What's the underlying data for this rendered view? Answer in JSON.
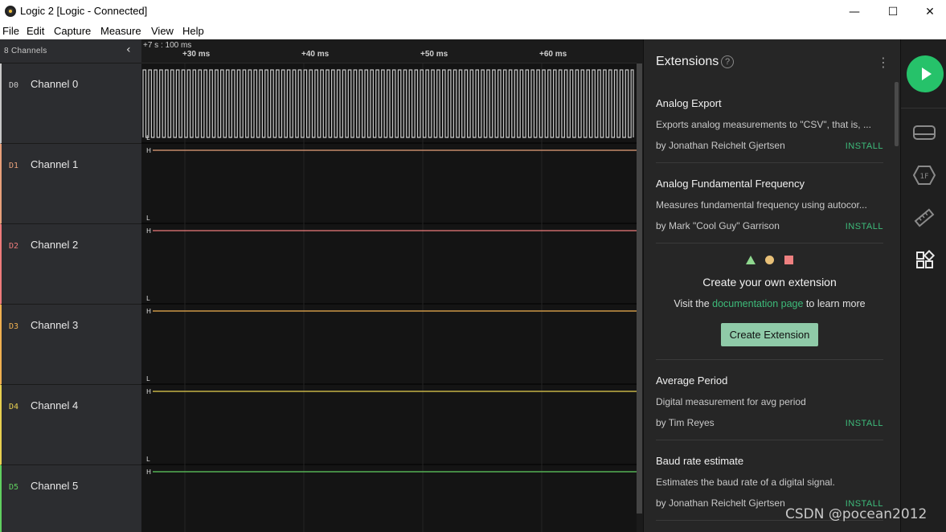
{
  "window": {
    "title": "Logic 2 [Logic - Connected]",
    "min_glyph": "—",
    "max_glyph": "☐",
    "close_glyph": "✕"
  },
  "menu": [
    "File",
    "Edit",
    "Capture",
    "Measure",
    "View",
    "Help"
  ],
  "channels_panel": {
    "header": "8 Channels",
    "collapse_glyph": "‹"
  },
  "channels": [
    {
      "id": "D0",
      "name": "Channel 0",
      "color": "#c8c8c8"
    },
    {
      "id": "D1",
      "name": "Channel 1",
      "color": "#e8a07a"
    },
    {
      "id": "D2",
      "name": "Channel 2",
      "color": "#ee7b7b"
    },
    {
      "id": "D3",
      "name": "Channel 3",
      "color": "#f0b050"
    },
    {
      "id": "D4",
      "name": "Channel 4",
      "color": "#e8d050"
    },
    {
      "id": "D5",
      "name": "Channel 5",
      "color": "#60d060"
    }
  ],
  "waveform": {
    "high_label": "H",
    "low_label": "L"
  },
  "ruler": {
    "offset": "+7 s : 100 ms",
    "ticks": [
      "+30 ms",
      "+40 ms",
      "+50 ms",
      "+60 ms"
    ]
  },
  "extensions": {
    "title": "Extensions",
    "help_glyph": "?",
    "more_glyph": "⋮",
    "items": [
      {
        "name": "Analog Export",
        "desc": "Exports analog measurements to \"CSV\", that is, ...",
        "author": "by Jonathan Reichelt Gjertsen",
        "action": "INSTALL"
      },
      {
        "name": "Analog Fundamental Frequency",
        "desc": "Measures fundamental frequency using autocor...",
        "author": "by Mark \"Cool Guy\" Garrison",
        "action": "INSTALL"
      },
      {
        "name": "Average Period",
        "desc": "Digital measurement for avg period",
        "author": "by Tim Reyes",
        "action": "INSTALL"
      },
      {
        "name": "Baud rate estimate",
        "desc": "Estimates the baud rate of a digital signal.",
        "author": "by Jonathan Reichelt Gjertsen",
        "action": "INSTALL"
      }
    ],
    "create": {
      "title": "Create your own extension",
      "line_before": "Visit the",
      "link": "documentation page",
      "line_after": "to learn more",
      "button": "Create Extension"
    }
  },
  "toolbar": {
    "play_color": "#26c26a",
    "icons": [
      "device-icon",
      "analyzer-1f-icon",
      "measure-ruler-icon",
      "extensions-icon"
    ]
  },
  "watermark": "CSDN @pocean2012"
}
